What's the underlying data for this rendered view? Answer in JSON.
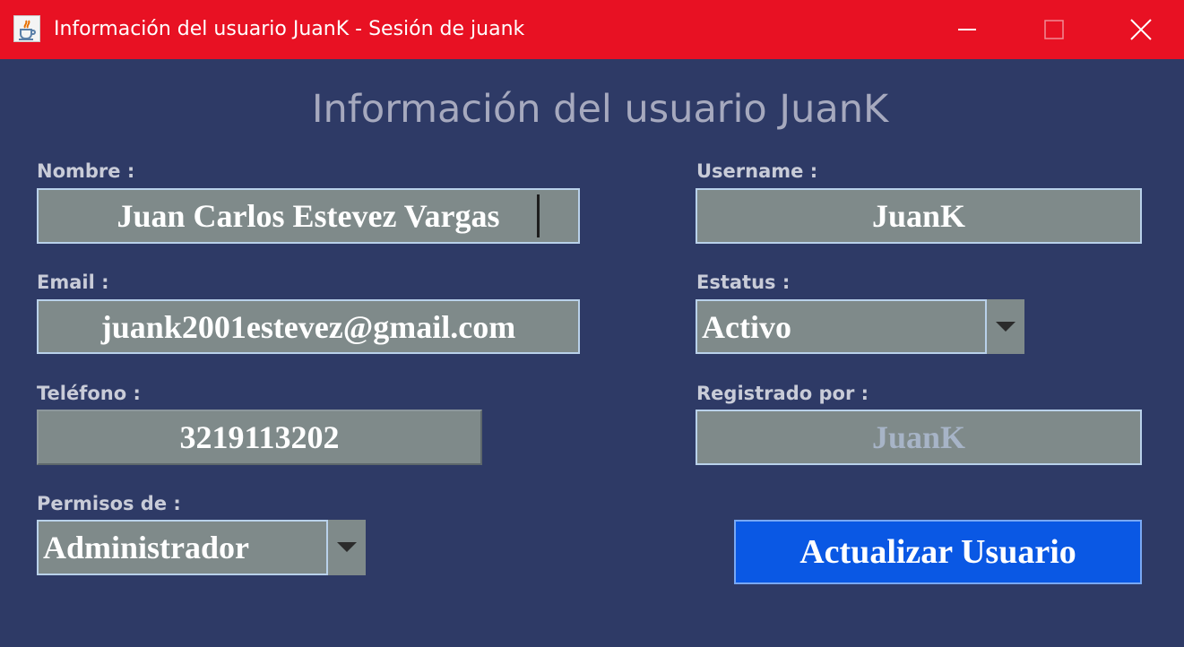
{
  "window": {
    "title": "Información del usuario JuanK - Sesión de juank",
    "app_icon": "java-cup-icon",
    "controls": {
      "minimize_icon": "minimize-icon",
      "maximize_icon": "maximize-icon",
      "close_icon": "close-icon"
    }
  },
  "heading": "Información del usuario JuanK",
  "form": {
    "nombre": {
      "label": "Nombre :",
      "value": "Juan Carlos Estevez Vargas"
    },
    "email": {
      "label": "Email :",
      "value": "juank2001estevez@gmail.com"
    },
    "telefono": {
      "label": "Teléfono :",
      "value": "3219113202"
    },
    "permisos": {
      "label": "Permisos de :",
      "selected": "Administrador",
      "arrow_icon": "chevron-down-icon"
    },
    "username": {
      "label": "Username :",
      "value": "JuanK"
    },
    "estatus": {
      "label": "Estatus :",
      "selected": "Activo",
      "arrow_icon": "chevron-down-icon"
    },
    "registrado_por": {
      "label": "Registrado por :",
      "value": "JuanK"
    }
  },
  "actions": {
    "update_label": "Actualizar Usuario"
  },
  "colors": {
    "titlebar": "#e81123",
    "background": "#2e3a66",
    "field": "#7f8a8a",
    "field_border": "#b9d1ea",
    "button": "#0a58e4",
    "heading_text": "#a6a9be"
  }
}
